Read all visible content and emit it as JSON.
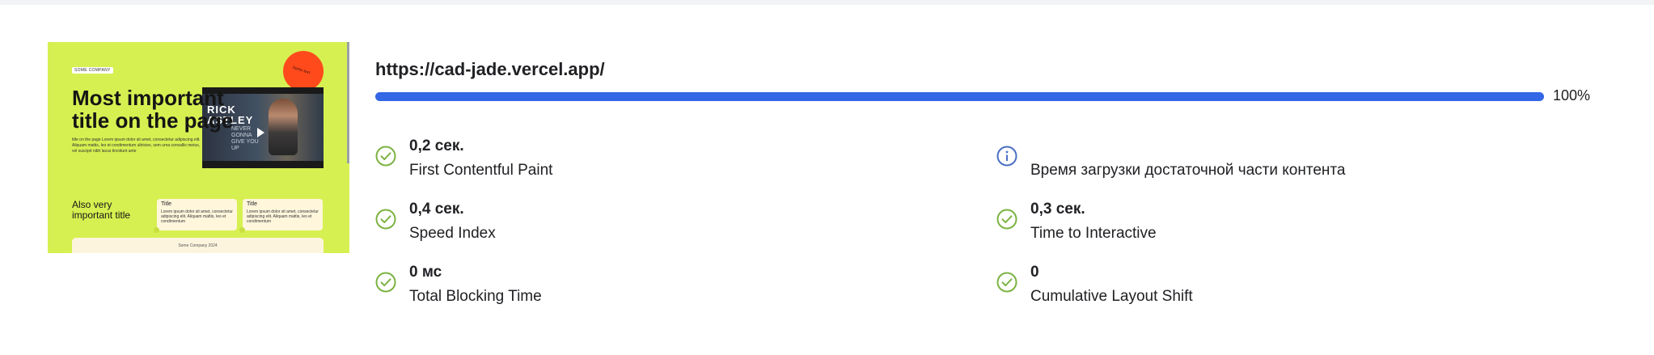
{
  "thumbnail": {
    "badge": "SOME COMPANY",
    "circle_text": "Some text",
    "heading": "Most important title on the page",
    "paragraph": "title on the page Lorem ipsum dolor sit amet, consectetur adipiscing elit. Aliquam mattis, leo et condimentum ultricies, sem urna convallis metus, vel suscipit nibh lacus tincidunt ante",
    "video_title": "RICK ASTLEY",
    "video_subtitle": "NEVER GONNA GIVE YOU UP",
    "subheading": "Also very important title",
    "cards": [
      {
        "title": "Title",
        "body": "Lorem ipsum dolor sit amet, consectetur adipiscing elit. Aliquam mattis, leo et condimentum"
      },
      {
        "title": "Title",
        "body": "Lorem ipsum dolor sit amet, consectetur adipiscing elit. Aliquam mattis, leo et condimentum"
      }
    ],
    "footer": "Some Company 2024"
  },
  "report": {
    "url": "https://cad-jade.vercel.app/",
    "progress_percent": 100,
    "progress_label": "100%",
    "progress_color": "#3367e5",
    "pass_color": "#7cb342",
    "info_color": "#4a6fc3",
    "metrics": [
      {
        "value": "0,2 сек.",
        "label": "First Contentful Paint",
        "status": "pass"
      },
      {
        "value": "",
        "label": "Время загрузки достаточной части контента",
        "status": "info"
      },
      {
        "value": "0,4 сек.",
        "label": "Speed Index",
        "status": "pass"
      },
      {
        "value": "0,3 сек.",
        "label": "Time to Interactive",
        "status": "pass"
      },
      {
        "value": "0 мс",
        "label": "Total Blocking Time",
        "status": "pass"
      },
      {
        "value": "0",
        "label": "Cumulative Layout Shift",
        "status": "pass"
      }
    ]
  }
}
